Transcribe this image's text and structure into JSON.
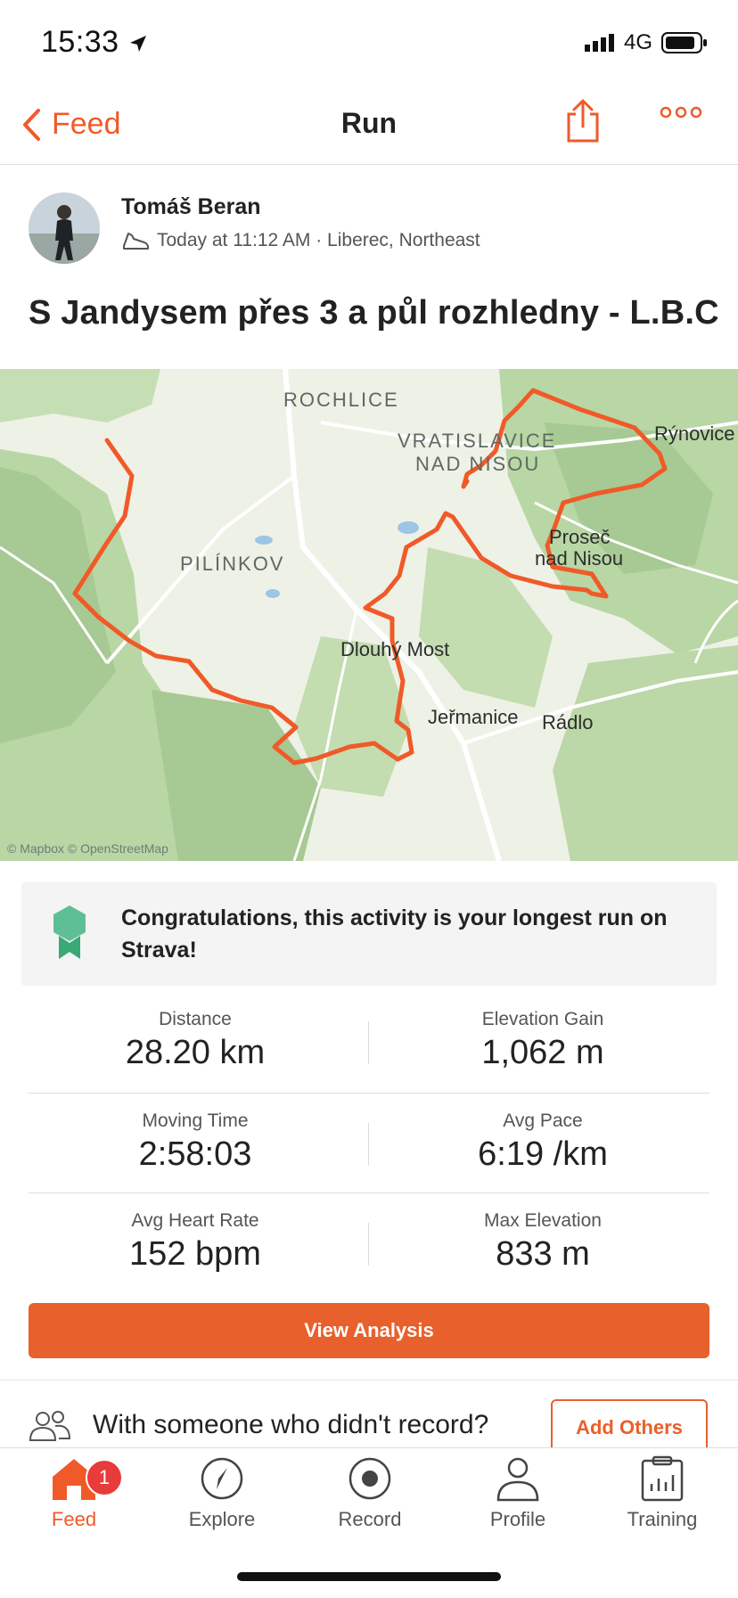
{
  "status_bar": {
    "time": "15:33",
    "network": "4G"
  },
  "nav": {
    "back_label": "Feed",
    "title": "Run"
  },
  "athlete": {
    "name": "Tomáš Beran",
    "meta": "Today at 11:12 AM · Liberec, Northeast"
  },
  "activity": {
    "title": "S Jandysem přes 3 a půl rozhledny - L.B.C"
  },
  "map": {
    "labels": {
      "rochlice": "ROCHLICE",
      "vratislavice_1": "VRATISLAVICE",
      "vratislavice_2": "NAD NISOU",
      "pilinkov": "PILÍNKOV",
      "rynovice": "Rýnovice",
      "proseč_1": "Proseč",
      "proseč_2": "nad Nisou",
      "dlouhy_most": "Dlouhý Most",
      "jermanice": "Jeřmanice",
      "radlo": "Rádlo"
    },
    "attribution": "© Mapbox © OpenStreetMap",
    "route_color": "#f05a28"
  },
  "achievement": {
    "text": "Congratulations, this activity is your longest run on Strava!"
  },
  "stats": {
    "distance": {
      "label": "Distance",
      "value": "28.20 km"
    },
    "elevation_gain": {
      "label": "Elevation Gain",
      "value": "1,062 m"
    },
    "moving_time": {
      "label": "Moving Time",
      "value": "2:58:03"
    },
    "avg_pace": {
      "label": "Avg Pace",
      "value": "6:19 /km"
    },
    "avg_hr": {
      "label": "Avg Heart Rate",
      "value": "152 bpm"
    },
    "max_elevation": {
      "label": "Max Elevation",
      "value": "833 m"
    }
  },
  "actions": {
    "view_analysis": "View Analysis",
    "others_prompt": "With someone who didn't record?",
    "add_others": "Add Others"
  },
  "tabbar": {
    "feed": "Feed",
    "feed_badge": "1",
    "explore": "Explore",
    "record": "Record",
    "profile": "Profile",
    "training": "Training"
  },
  "colors": {
    "accent": "#f05a28"
  }
}
